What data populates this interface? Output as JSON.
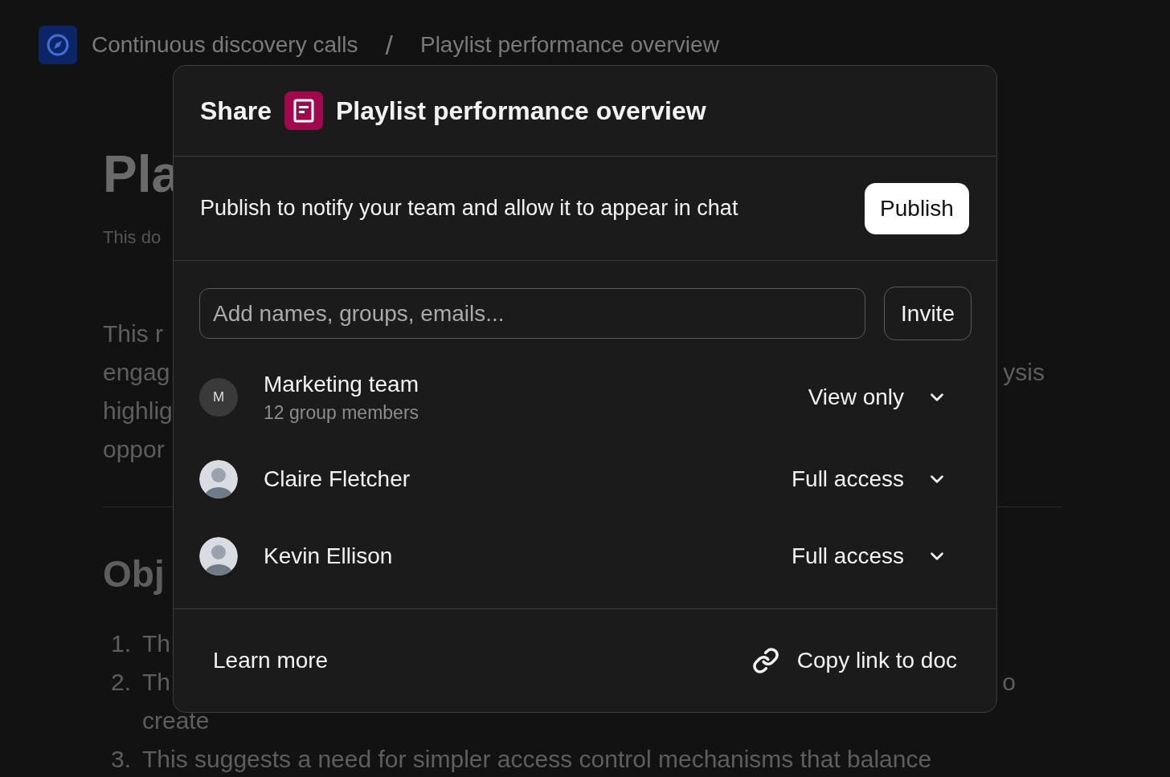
{
  "breadcrumb": {
    "items": [
      "Continuous discovery calls",
      "Playlist performance overview"
    ],
    "separator": "/"
  },
  "document": {
    "title": "Pla",
    "subtitle": "This do",
    "paragraph_lines": [
      {
        "left": "This r"
      },
      {
        "left": "engag",
        "right": "ysis"
      },
      {
        "left": "highlig"
      },
      {
        "left": "oppor"
      }
    ],
    "section_heading": "Obj",
    "list_lines": [
      {
        "marker": "1.",
        "text": "Th"
      },
      {
        "marker": "2.",
        "text": "Th",
        "right": "o"
      },
      {
        "text": "create"
      },
      {
        "marker": "3.",
        "text": "This suggests a need for simpler access control mechanisms that balance"
      }
    ]
  },
  "share_dialog": {
    "title": "Share",
    "doc_title": "Playlist performance overview",
    "publish": {
      "text": "Publish to notify your team and allow it to appear in chat",
      "button": "Publish"
    },
    "invite": {
      "placeholder": "Add names, groups, emails...",
      "button": "Invite"
    },
    "members": [
      {
        "name": "Marketing team",
        "subtitle": "12 group members",
        "avatar": {
          "kind": "initial",
          "initial": "M"
        },
        "access": "View only"
      },
      {
        "name": "Claire Fletcher",
        "avatar": {
          "kind": "photo"
        },
        "access": "Full access"
      },
      {
        "name": "Kevin Ellison",
        "avatar": {
          "kind": "photo"
        },
        "access": "Full access"
      }
    ],
    "footer": {
      "learn_more": "Learn more",
      "copy_link": "Copy link to doc"
    }
  }
}
